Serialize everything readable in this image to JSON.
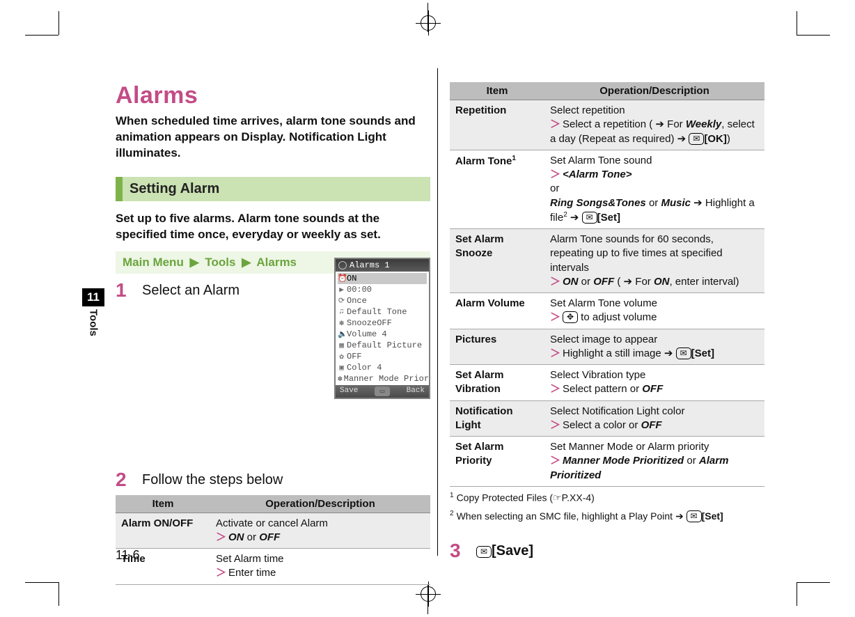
{
  "sidetab": {
    "number": "11",
    "label": "Tools"
  },
  "title": "Alarms",
  "lead": "When scheduled time arrives, alarm tone sounds and animation appears on Display. Notification Light illuminates.",
  "band": "Setting Alarm",
  "para1": "Set up to five alarms. Alarm tone sounds at the specified time once, everyday or weekly as set.",
  "breadcrumb": {
    "a": "Main Menu",
    "b": "Tools",
    "c": "Alarms"
  },
  "steps": {
    "s1": {
      "n": "1",
      "t": "Select an Alarm"
    },
    "s2": {
      "n": "2",
      "t": "Follow the steps below"
    },
    "s3": {
      "n": "3",
      "t": "[Save]"
    }
  },
  "phone": {
    "title": "Alarms 1",
    "items": [
      "ON",
      "00:00",
      "Once",
      "Default Tone",
      "SnoozeOFF",
      "Volume 4",
      "Default Picture",
      "OFF",
      "Color 4",
      "Manner Mode Prior"
    ],
    "footer": {
      "left": "Save",
      "mid": "▭",
      "right": "Back"
    }
  },
  "table": {
    "head": {
      "item": "Item",
      "op": "Operation/Description"
    },
    "left": [
      {
        "item": "Alarm ON/OFF",
        "desc": "Activate or cancel Alarm",
        "action_html": "<span class='chev'>＞</span><span class='boldit'>ON</span> or <span class='boldit'>OFF</span>"
      },
      {
        "item": "Time",
        "desc": "Set Alarm time",
        "action_html": "<span class='chev'>＞</span>Enter time"
      }
    ],
    "right": [
      {
        "item": "Repetition",
        "desc": "Select repetition",
        "action_html": "<span class='chev'>＞</span>Select a repetition ( <span class='arrow'>➔</span> For <span class='boldit'>Weekly</span>, select a day (Repeat as required) <span class='arrow'>➔</span> <span class='keycap'>✉</span><b>[OK]</b>)"
      },
      {
        "item_html": "Alarm Tone<sup>1</sup>",
        "desc": "Set Alarm Tone sound",
        "action_html": "<span class='chev'>＞</span><span class='boldit'>&lt;Alarm Tone&gt;</span><br>or<br><span class='boldit'>Ring Songs&amp;Tones</span> or <span class='boldit'>Music</span> <span class='arrow'>➔</span> Highlight a file<sup>2</sup> <span class='arrow'>➔</span> <span class='keycap'>✉</span><b>[Set]</b>"
      },
      {
        "item": "Set Alarm Snooze",
        "desc": "Alarm Tone sounds for 60 seconds, repeating up to five times at specified intervals",
        "action_html": "<span class='chev'>＞</span><span class='boldit'>ON</span> or <span class='boldit'>OFF</span> ( <span class='arrow'>➔</span> For <span class='boldit'>ON</span>, enter interval)"
      },
      {
        "item": "Alarm Volume",
        "desc": "Set Alarm Tone volume",
        "action_html": "<span class='chev'>＞</span><span class='keycap'>✥</span> to adjust volume"
      },
      {
        "item": "Pictures",
        "desc": "Select image to appear",
        "action_html": "<span class='chev'>＞</span>Highlight a still image <span class='arrow'>➔</span> <span class='keycap'>✉</span><b>[Set]</b>"
      },
      {
        "item": "Set Alarm Vibration",
        "desc": "Select Vibration type",
        "action_html": "<span class='chev'>＞</span>Select pattern or <span class='boldit'>OFF</span>"
      },
      {
        "item": "Notification Light",
        "desc": "Select Notification Light color",
        "action_html": "<span class='chev'>＞</span>Select a color or <span class='boldit'>OFF</span>"
      },
      {
        "item": "Set Alarm Priority",
        "desc": "Set Manner Mode or Alarm priority",
        "action_html": "<span class='chev'>＞</span><span class='boldit'>Manner Mode Prioritized</span> or <span class='boldit'>Alarm Prioritized</span>"
      }
    ]
  },
  "footnotes": {
    "f1": "Copy Protected Files (☞P.XX-4)",
    "f2_html": "When selecting an SMC file, highlight a Play Point <span class='arrow'>➔</span> <span class='keycap'>✉</span><b>[Set]</b>"
  },
  "pagefoot": "11-6"
}
